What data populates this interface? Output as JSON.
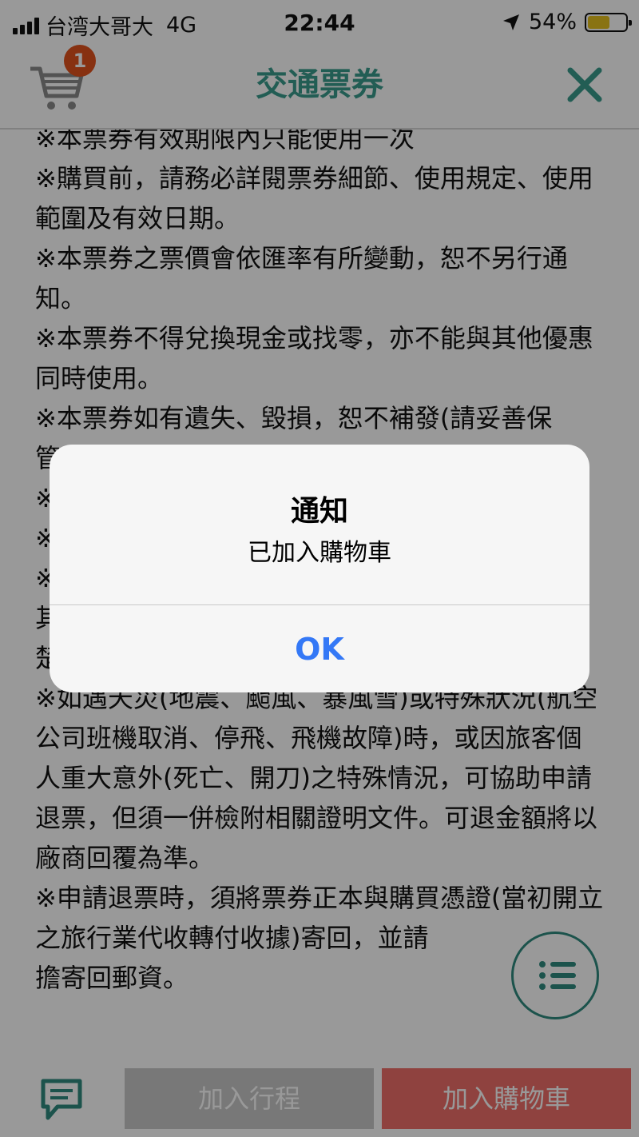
{
  "status_bar": {
    "carrier": "台湾大哥大",
    "network": "4G",
    "time": "22:44",
    "battery_percent": "54%",
    "battery_level": 0.54,
    "battery_color": "#e4c01e",
    "icons": [
      "signal-icon",
      "location-arrow-icon",
      "battery-icon"
    ]
  },
  "header": {
    "title": "交通票券",
    "cart_badge_count": "1",
    "accent_color": "#3a9b8c",
    "badge_color": "#e2521d"
  },
  "content": {
    "lines": [
      "※本票券有效期限內只能使用一次",
      "※購買前，請務必詳閱票券細節、使用規定、使用範圍及有效日期。",
      "※本票券之票價會依匯率有所變動，恕不另行通知。",
      "※本票券不得兌換現金或找零，亦不能與其他優惠同時使用。",
      "※本票券如有遺失、毀損，恕不補發(請妥善保管)；票券若毀損至無法辨識、塗改或影印者視為",
      "※",
      "※",
      "※",
      "其",
      "楚。",
      "※如遇天災(地震、颱風、暴風雪)或特殊狀況(航空公司班機取消、停飛、飛機故障)時，或因旅客個人重大意外(死亡、開刀)之特殊情況，可協助申請退票，但須一併檢附相關證明文件。可退金額將以廠商回覆為準。",
      "※申請退票時，須將票券正本與購買憑證(當初開立之旅行業代收轉付收據)寄回，並請",
      "擔寄回郵資。"
    ]
  },
  "bottom_bar": {
    "add_trip_label": "加入行程",
    "add_cart_label": "加入購物車",
    "cart_button_color": "#ef6f69"
  },
  "alert": {
    "title": "通知",
    "message": "已加入購物車",
    "ok_label": "OK",
    "ok_color": "#3478f6"
  }
}
